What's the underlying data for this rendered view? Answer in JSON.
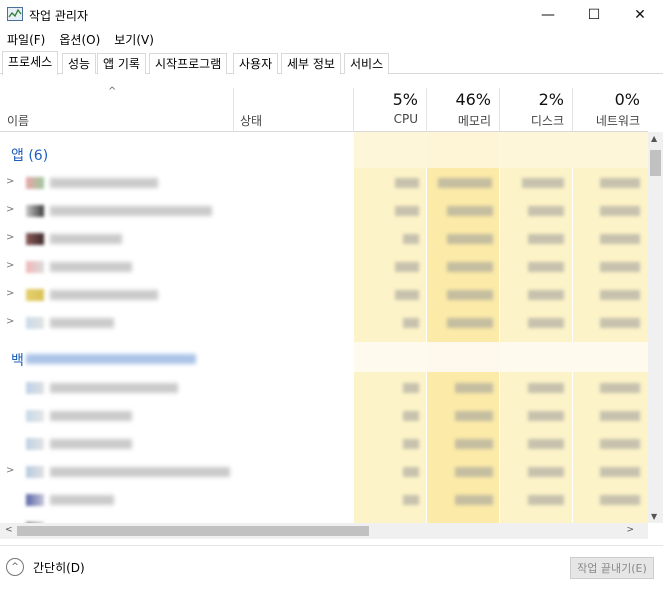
{
  "window": {
    "title": "작업 관리자",
    "min_glyph": "—",
    "max_glyph": "☐",
    "close_glyph": "✕"
  },
  "menu": [
    "파일(F)",
    "옵션(O)",
    "보기(V)"
  ],
  "tabs": [
    "프로세스",
    "성능",
    "앱 기록",
    "시작프로그램",
    "사용자",
    "세부 정보",
    "서비스"
  ],
  "columns": {
    "sort_glyph": "^",
    "name": "이름",
    "status": "상태",
    "cpu": {
      "pct": "5%",
      "label": "CPU"
    },
    "memory": {
      "pct": "46%",
      "label": "메모리"
    },
    "disk": {
      "pct": "2%",
      "label": "디스크"
    },
    "network": {
      "pct": "0%",
      "label": "네트워크"
    }
  },
  "groups": {
    "apps": "앱 (6)",
    "background": "백"
  },
  "expander_glyph": ">",
  "scroll": {
    "up": "▲",
    "down": "▼",
    "left": "<",
    "right": ">"
  },
  "footer": {
    "collapse_icon_glyph": "^",
    "collapse_label": "간단히(D)",
    "end_task": "작업 끝내기(E)"
  },
  "colors": {
    "heat_light": "#fdf6d6",
    "heat_mid": "#fbeeb1",
    "heat_strong": "#f9e08f",
    "link_blue": "#1d5fbf"
  }
}
